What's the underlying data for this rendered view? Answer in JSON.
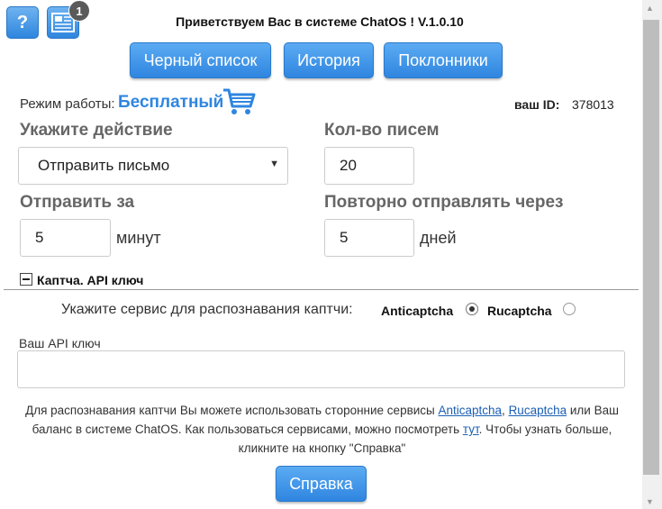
{
  "header": {
    "help_label": "?",
    "notifications_badge": "1",
    "title": "Приветствуем Вас в системе ChatOS ! V.1.0.10"
  },
  "nav": {
    "blacklist": "Черный список",
    "history": "История",
    "fans": "Поклонники"
  },
  "mode": {
    "label": "Режим работы:",
    "value": "Бесплатный",
    "id_label": "ваш ID:",
    "id_value": "378013"
  },
  "form": {
    "action_label": "Укажите действие",
    "action_value": "Отправить письмо",
    "count_label": "Кол-во писем",
    "count_value": "20",
    "send_for_label": "Отправить за",
    "send_for_value": "5",
    "send_for_unit": "минут",
    "repeat_label": "Повторно отправлять через",
    "repeat_value": "5",
    "repeat_unit": "дней"
  },
  "captcha": {
    "section_title": "Каптча. API ключ",
    "service_prompt": "Укажите сервис для распознавания каптчи:",
    "option1": "Anticaptcha",
    "option2": "Rucaptcha",
    "api_key_label": "Ваш API ключ",
    "api_key_value": "",
    "info_text_1": "Для распознавания каптчи Вы можете использовать сторонние сервисы ",
    "info_link_1": "Anticaptcha",
    "info_sep": ", ",
    "info_link_2": "Rucaptcha",
    "info_text_2": " или Ваш баланс в системе ChatOS. Как пользоваться сервисами, можно посмотреть ",
    "info_link_3": "тут",
    "info_text_3": ". Чтобы узнать больше, кликните на кнопку \"Справка\"",
    "help_button": "Справка"
  }
}
